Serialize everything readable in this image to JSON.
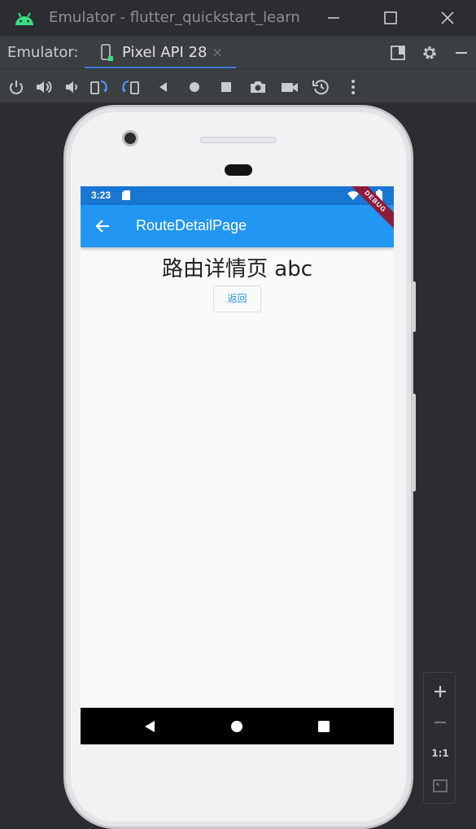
{
  "window": {
    "title": "Emulator - flutter_quickstart_learn",
    "app_icon": "android-icon",
    "controls": [
      "minimize-icon",
      "maximize-icon",
      "close-icon"
    ]
  },
  "tabbar": {
    "label": "Emulator:",
    "tab": {
      "label": "Pixel API 28",
      "close": "×",
      "icon": "device-phone-icon"
    },
    "right_icons": [
      "layout-icon",
      "gear-icon",
      "minimize-icon"
    ]
  },
  "toolbar": {
    "tools": [
      "power-icon",
      "volume-up-icon",
      "volume-down-icon",
      "rotate-left-icon",
      "rotate-right-icon",
      "back-icon",
      "home-icon",
      "overview-icon",
      "screenshot-icon",
      "record-icon",
      "snapshot-icon",
      "more-icon"
    ]
  },
  "phone": {
    "status_bar": {
      "time": "3:23",
      "color": "#1976d2"
    },
    "app_bar": {
      "title": "RouteDetailPage",
      "color": "#2196f3"
    },
    "debug_banner": "DEBUG",
    "heading": "路由详情页 abc",
    "back_button": "返回",
    "nav_buttons": [
      "nav-back-icon",
      "nav-home-icon",
      "nav-recents-icon"
    ]
  },
  "zoom": {
    "zoom_in": "+",
    "zoom_out": "−",
    "actual_size": "1:1",
    "fit": "fit-screen-icon"
  }
}
